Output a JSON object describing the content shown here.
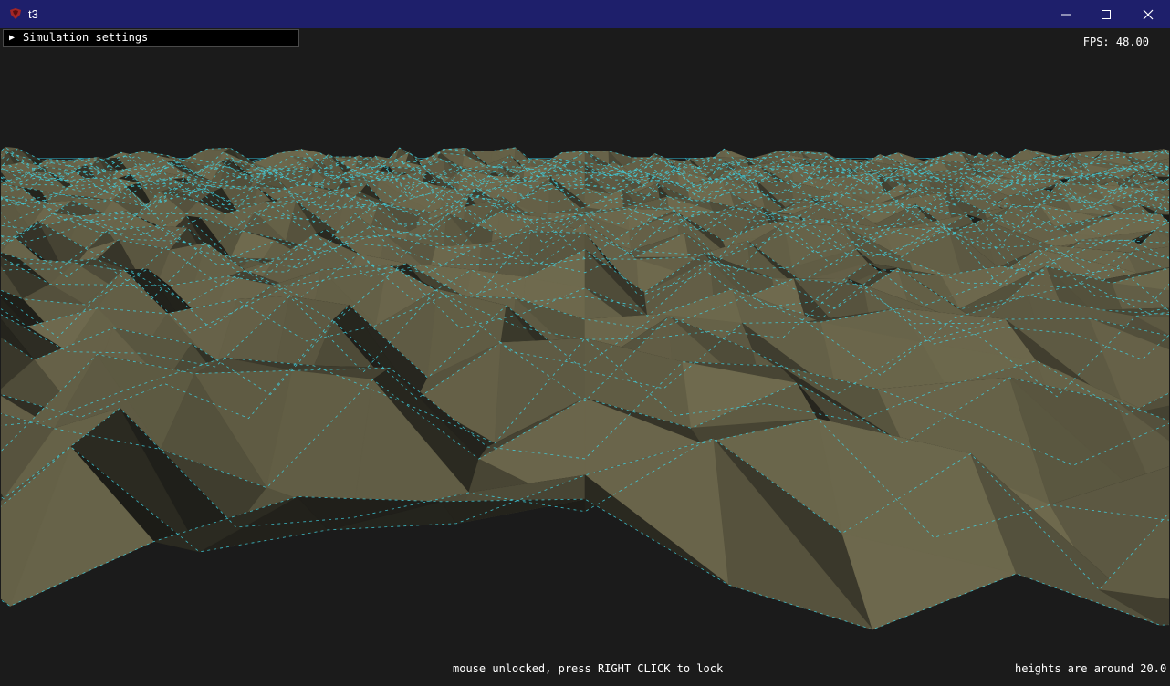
{
  "window": {
    "title": "t3",
    "icons": {
      "app": "app-icon",
      "minimize": "minimize-icon",
      "maximize": "maximize-icon",
      "close": "close-icon"
    }
  },
  "viewport": {
    "settings_label": "Simulation settings",
    "settings_icon": "triangle-right-icon",
    "fps_text": "FPS: 48.00",
    "status_mouse": "mouse unlocked, press RIGHT CLICK to lock",
    "status_heights": "heights are around 20.0"
  },
  "colors": {
    "titlebar": "#1e1f6b",
    "background": "#1b1b1b",
    "grid": "#2fb8d0",
    "terrain_light": "#6f6a4e",
    "terrain_dark": "#1a1a16",
    "wire": "#3fd6e6"
  }
}
